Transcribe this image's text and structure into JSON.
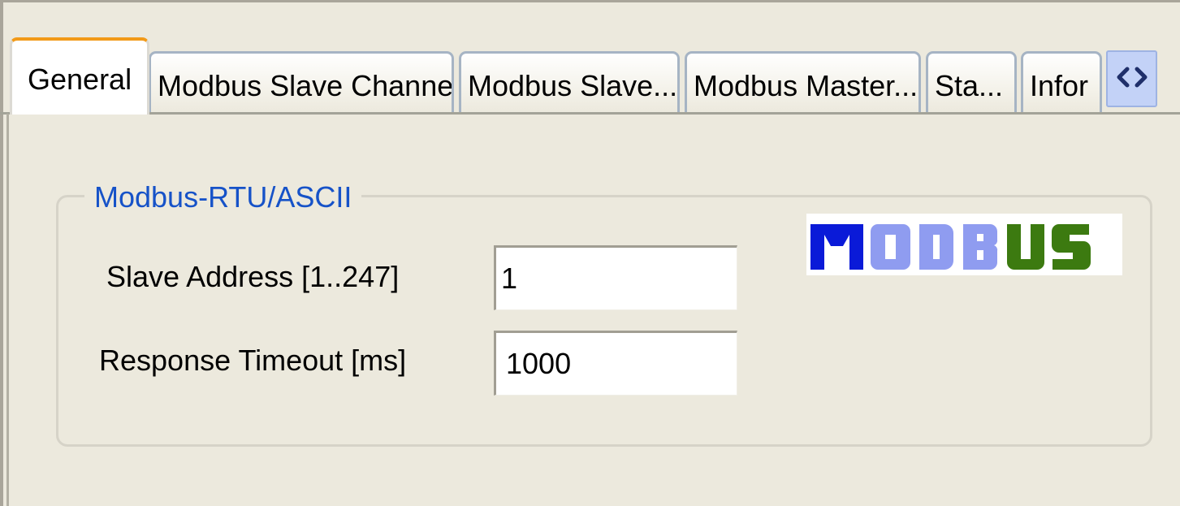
{
  "tabs": [
    {
      "label": "General",
      "active": true
    },
    {
      "label": "Modbus Slave Channel",
      "active": false
    },
    {
      "label": "Modbus Slave...",
      "active": false
    },
    {
      "label": "Modbus Master...",
      "active": false
    },
    {
      "label": "Sta...",
      "active": false
    },
    {
      "label": "Infor",
      "active": false
    }
  ],
  "tab_scroll_icon": "left-right-chevrons-icon",
  "group": {
    "title": "Modbus-RTU/ASCII",
    "fields": [
      {
        "label": "Slave Address [1..247]",
        "value": "1"
      },
      {
        "label": "Response Timeout [ms]",
        "value": "1000"
      }
    ]
  },
  "logo": {
    "text": "MODBUS",
    "colors": {
      "M": "#0a1ad8",
      "ODB": "#8f9cf0",
      "US": "#3c7a10"
    }
  },
  "colors": {
    "background": "#ece9dd",
    "active_tab_accent": "#f29a18",
    "group_title": "#1652c8",
    "tab_border": "#a6b4c4"
  }
}
